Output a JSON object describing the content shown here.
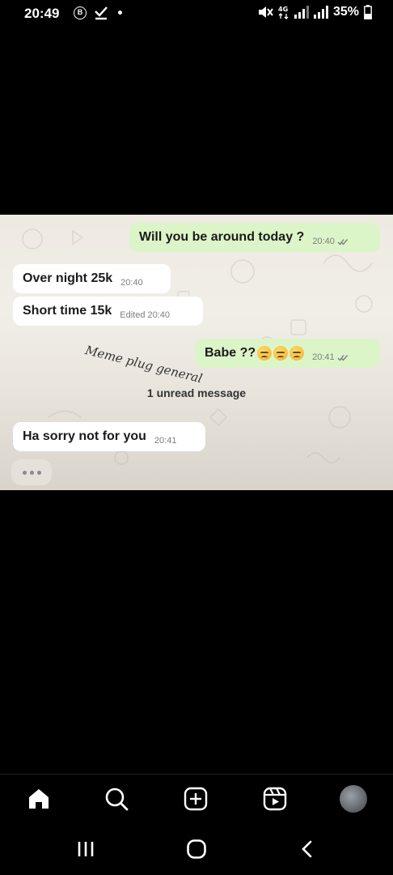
{
  "status_bar": {
    "time": "20:49",
    "b_badge": "B",
    "battery_text": "35%",
    "icons": [
      "b-circle-icon",
      "download-check-icon",
      "dot-icon",
      "mute-icon",
      "4g-icon",
      "signal-icon",
      "signal-icon",
      "battery-icon"
    ]
  },
  "chat": {
    "messages": [
      {
        "direction": "outgoing",
        "text": "Will you be around today ?",
        "time": "20:40",
        "ticks": "double-check"
      },
      {
        "direction": "incoming",
        "text": "Over night 25k",
        "time": "20:40"
      },
      {
        "direction": "incoming",
        "text": "Short time 15k",
        "time": "Edited 20:40"
      },
      {
        "direction": "outgoing",
        "text": "Babe ??",
        "emoji_count": 3,
        "time": "20:41",
        "ticks": "double-check"
      },
      {
        "direction": "incoming",
        "text": "Ha sorry not for you",
        "time": "20:41"
      }
    ],
    "watermark": "Meme plug general",
    "unread_label": "1 unread message"
  },
  "bottom_nav": {
    "items": [
      "home-icon",
      "search-icon",
      "create-icon",
      "reels-icon",
      "profile-avatar"
    ]
  },
  "system_nav": {
    "items": [
      "recents-icon",
      "home-circle-icon",
      "back-icon"
    ]
  },
  "colors": {
    "background": "#000000",
    "outgoing_bubble": "#dcf5c8",
    "incoming_bubble": "#ffffff",
    "chat_wallpaper": "#eeeae2"
  }
}
